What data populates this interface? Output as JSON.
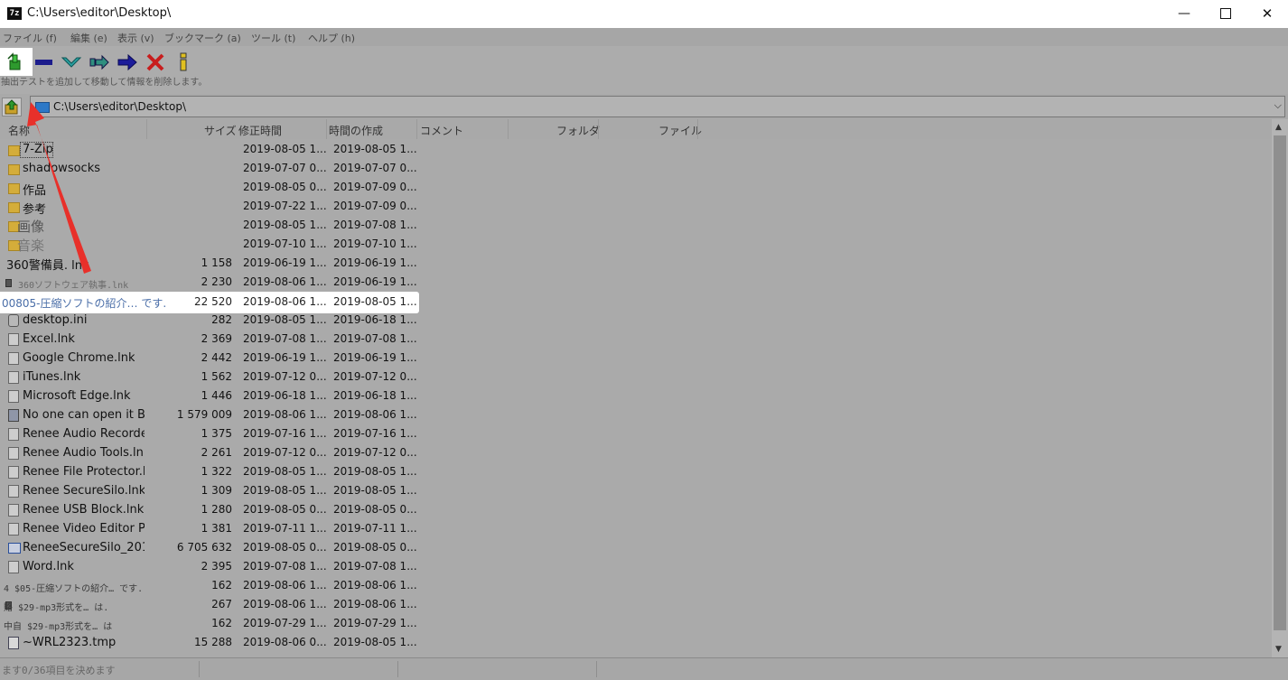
{
  "window": {
    "app_icon": "7z",
    "title": "C:\\Users\\editor\\Desktop\\",
    "minimize": "—",
    "close": "✕"
  },
  "menu": [
    "ファイル (f)",
    "編集 (e)",
    "表示 (v)",
    "ブックマーク (a)",
    "ツール (t)",
    "ヘルプ (h)"
  ],
  "toolbar": {
    "buttons": [
      "add-icon",
      "extract-icon",
      "test-icon",
      "copy-icon",
      "move-icon",
      "delete-icon",
      "info-icon"
    ],
    "tooltip": "抽出テストを追加して移動して情報を削除します。"
  },
  "address": {
    "path": "C:\\Users\\editor\\Desktop\\",
    "dropdown": "⌵"
  },
  "columns": {
    "name": "名称",
    "size": "サイズ",
    "modified": "修正時間",
    "created": "時間の作成",
    "comment": "コメント",
    "folders": "フォルダ",
    "files": "ファイル"
  },
  "files": [
    {
      "name": "7-Zip",
      "size": "",
      "modified": "2019-08-05 1...",
      "created": "2019-08-05 1...",
      "icon": "folder"
    },
    {
      "name": "shadowsocks",
      "size": "",
      "modified": "2019-07-07 0...",
      "created": "2019-07-07 0...",
      "icon": "folder"
    },
    {
      "name": "作品",
      "size": "",
      "modified": "2019-08-05 0...",
      "created": "2019-07-09 0...",
      "icon": "folder"
    },
    {
      "name": "参考",
      "size": "",
      "modified": "2019-07-22 1...",
      "created": "2019-07-09 0...",
      "icon": "folder"
    },
    {
      "name": "画像",
      "size": "",
      "modified": "2019-08-05 1...",
      "created": "2019-07-08 1...",
      "icon": "folder",
      "style": "bigtxt"
    },
    {
      "name": "音楽",
      "size": "",
      "modified": "2019-07-10 1...",
      "created": "2019-07-10 1...",
      "icon": "folder",
      "style": "bigtxt faint"
    },
    {
      "name": "360警備員.    lnk",
      "size": "1 158",
      "modified": "2019-06-19 1...",
      "created": "2019-06-19 1...",
      "icon": "none",
      "style": "mixed"
    },
    {
      "name": "360ソフトウェア執事.lnk",
      "size": "2 230",
      "modified": "2019-08-06 1...",
      "created": "2019-06-19 1...",
      "icon": "small",
      "style": "tiny"
    },
    {
      "name": "00805-圧縮ソフトの紹介…  です.",
      "size": "22 520",
      "modified": "2019-08-06 1...",
      "created": "2019-08-05 1...",
      "icon": "none",
      "style": "hilite"
    },
    {
      "name": "desktop.ini",
      "size": "282",
      "modified": "2019-08-05 1...",
      "created": "2019-06-18 1...",
      "icon": "gear"
    },
    {
      "name": "Excel.lnk",
      "size": "2 369",
      "modified": "2019-07-08 1...",
      "created": "2019-07-08 1...",
      "icon": "file"
    },
    {
      "name": "Google Chrome.lnk",
      "size": "2 442",
      "modified": "2019-06-19 1...",
      "created": "2019-06-19 1...",
      "icon": "file"
    },
    {
      "name": "iTunes.lnk",
      "size": "1 562",
      "modified": "2019-07-12 0...",
      "created": "2019-07-12 0...",
      "icon": "file"
    },
    {
      "name": "Microsoft Edge.lnk",
      "size": "1 446",
      "modified": "2019-06-18 1...",
      "created": "2019-06-18 1...",
      "icon": "file"
    },
    {
      "name": "No one can open it B...",
      "size": "1 579 009",
      "modified": "2019-08-06 1...",
      "created": "2019-08-06 1...",
      "icon": "lock"
    },
    {
      "name": "Renee Audio Recorde...",
      "size": "1 375",
      "modified": "2019-07-16 1...",
      "created": "2019-07-16 1...",
      "icon": "file"
    },
    {
      "name": "Renee Audio Tools.lnk",
      "size": "2 261",
      "modified": "2019-07-12 0...",
      "created": "2019-07-12 0...",
      "icon": "file"
    },
    {
      "name": "Renee File Protector.l...",
      "size": "1 322",
      "modified": "2019-08-05 1...",
      "created": "2019-08-05 1...",
      "icon": "file"
    },
    {
      "name": "Renee SecureSilo.lnk",
      "size": "1 309",
      "modified": "2019-08-05 1...",
      "created": "2019-08-05 1...",
      "icon": "file"
    },
    {
      "name": "Renee USB Block.lnk",
      "size": "1 280",
      "modified": "2019-08-05 0...",
      "created": "2019-08-05 0...",
      "icon": "file"
    },
    {
      "name": "Renee Video Editor P...",
      "size": "1 381",
      "modified": "2019-07-11 1...",
      "created": "2019-07-11 1...",
      "icon": "file"
    },
    {
      "name": "ReneeSecureSilo_201...",
      "size": "6 705 632",
      "modified": "2019-08-05 0...",
      "created": "2019-08-05 0...",
      "icon": "exe"
    },
    {
      "name": "Word.lnk",
      "size": "2 395",
      "modified": "2019-07-08 1...",
      "created": "2019-07-08 1...",
      "icon": "file"
    },
    {
      "name": "4 $05-圧縮ソフトの紹介… です.",
      "size": "162",
      "modified": "2019-08-06 1...",
      "created": "2019-08-06 1...",
      "icon": "none",
      "style": "tinyleft faint"
    },
    {
      "name": "賂 $29-mp3形式を… は.",
      "size": "267",
      "modified": "2019-08-06 1...",
      "created": "2019-08-06 1...",
      "icon": "small",
      "style": "tinyleft"
    },
    {
      "name": "中自 $29-mp3形式を… は",
      "size": "162",
      "modified": "2019-07-29 1...",
      "created": "2019-07-29 1...",
      "icon": "none",
      "style": "tinyleft"
    },
    {
      "name": "~WRL2323.tmp",
      "size": "15 288",
      "modified": "2019-08-06 0...",
      "created": "2019-08-05 1...",
      "icon": "file2"
    }
  ],
  "status": {
    "text": "ます0/36項目を決めます"
  },
  "scrollbar": {
    "up": "▲",
    "down": "▼"
  },
  "colors": {
    "annotation_arrow": "#e8302a",
    "highlight_bg": "#ffffff"
  }
}
